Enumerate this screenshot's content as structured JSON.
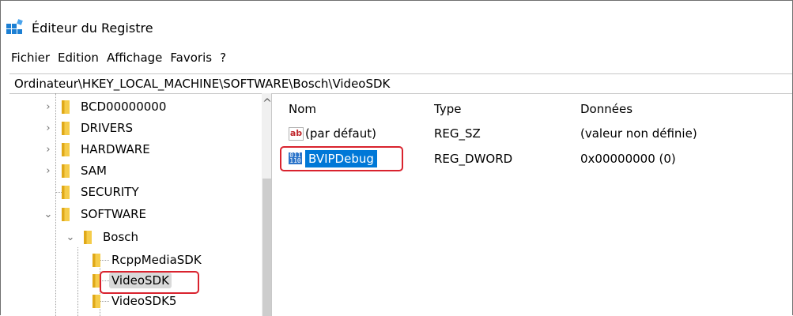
{
  "window": {
    "title": "Éditeur du Registre"
  },
  "menu": [
    "Fichier",
    "Edition",
    "Affichage",
    "Favoris",
    "?"
  ],
  "address": "Ordinateur\\HKEY_LOCAL_MACHINE\\SOFTWARE\\Bosch\\VideoSDK",
  "tree": {
    "items": [
      {
        "label": "BCD00000000",
        "toggle": "›"
      },
      {
        "label": "DRIVERS",
        "toggle": "›"
      },
      {
        "label": "HARDWARE",
        "toggle": "›"
      },
      {
        "label": "SAM",
        "toggle": "›"
      },
      {
        "label": "SECURITY",
        "toggle": ""
      },
      {
        "label": "SOFTWARE",
        "toggle": "⌄"
      },
      {
        "label": "Bosch",
        "toggle": "⌄"
      },
      {
        "label": "RcppMediaSDK",
        "toggle": ""
      },
      {
        "label": "VideoSDK",
        "toggle": ""
      },
      {
        "label": "VideoSDK5",
        "toggle": ""
      }
    ]
  },
  "list": {
    "headers": {
      "name": "Nom",
      "type": "Type",
      "data": "Données"
    },
    "rows": [
      {
        "name": "(par défaut)",
        "type": "REG_SZ",
        "data": "(valeur non définie)",
        "icon": "string-value-icon"
      },
      {
        "name": "BVIPDebug",
        "type": "REG_DWORD",
        "data": "0x00000000 (0)",
        "icon": "binary-value-icon"
      }
    ]
  },
  "colors": {
    "accent": "#0078d7",
    "highlight_border": "#d9232e",
    "folder": "#f5cc4a"
  }
}
